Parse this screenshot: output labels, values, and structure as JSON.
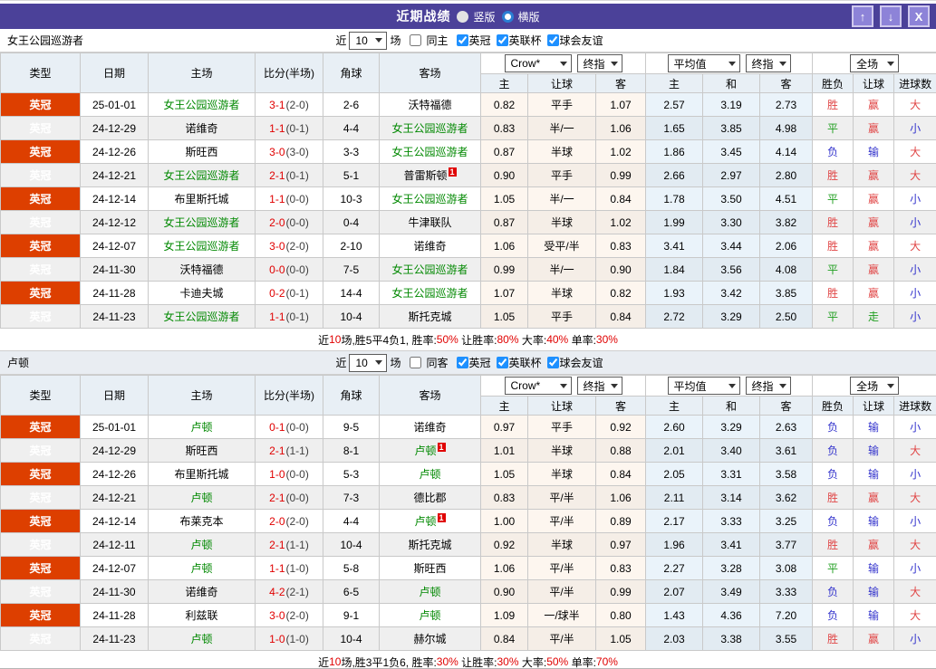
{
  "titlebar": {
    "title": "近期战绩",
    "radios": [
      {
        "label": "竖版",
        "selected": false
      },
      {
        "label": "横版",
        "selected": true
      }
    ],
    "icons": {
      "up": "↑",
      "down": "↓",
      "close": "X"
    }
  },
  "colors": {
    "accent_purple": "#4b4199",
    "button_purple": "#8d83d8",
    "league_red": "#dd3f00",
    "team_green": "#008800",
    "score_red": "#e00000",
    "result_red": "#e04545",
    "result_green": "#1f9e1f",
    "result_blue": "#3333cc",
    "checkbox_blue": "#1e90ff"
  },
  "table_header": {
    "cols": [
      "类型",
      "日期",
      "主场",
      "比分(半场)",
      "角球",
      "客场"
    ],
    "crow_select": "Crow*",
    "final_select": "终指",
    "avg_select": "平均值",
    "avg_final_select": "终指",
    "full_select": "全场",
    "sub": [
      "主",
      "让球",
      "客",
      "主",
      "和",
      "客",
      "胜负",
      "让球",
      "进球数"
    ]
  },
  "sections": [
    {
      "team": "女王公园巡游者",
      "filters": {
        "near": "近",
        "games": "10",
        "games_suffix": "场",
        "same_label": "同主",
        "same_checked": false,
        "comps": [
          {
            "label": "英冠",
            "checked": true
          },
          {
            "label": "英联杯",
            "checked": true
          },
          {
            "label": "球会友谊",
            "checked": true
          }
        ]
      },
      "rows": [
        {
          "league": "英冠",
          "date": "25-01-01",
          "home": "女王公园巡游者",
          "home_hl": true,
          "home_badge": "",
          "ft": "3-1",
          "ht": "(2-0)",
          "corners": "2-6",
          "away": "沃特福德",
          "away_hl": false,
          "away_badge": "",
          "crow": [
            "0.82",
            "平手",
            "1.07"
          ],
          "avg": [
            "2.57",
            "3.19",
            "2.73"
          ],
          "result": [
            "胜",
            "赢",
            "大"
          ]
        },
        {
          "league": "英冠",
          "date": "24-12-29",
          "home": "诺维奇",
          "home_hl": false,
          "home_badge": "",
          "ft": "1-1",
          "ht": "(0-1)",
          "corners": "4-4",
          "away": "女王公园巡游者",
          "away_hl": true,
          "away_badge": "",
          "crow": [
            "0.83",
            "半/一",
            "1.06"
          ],
          "avg": [
            "1.65",
            "3.85",
            "4.98"
          ],
          "result": [
            "平",
            "赢",
            "小"
          ]
        },
        {
          "league": "英冠",
          "date": "24-12-26",
          "home": "斯旺西",
          "home_hl": false,
          "home_badge": "",
          "ft": "3-0",
          "ht": "(3-0)",
          "corners": "3-3",
          "away": "女王公园巡游者",
          "away_hl": true,
          "away_badge": "",
          "crow": [
            "0.87",
            "半球",
            "1.02"
          ],
          "avg": [
            "1.86",
            "3.45",
            "4.14"
          ],
          "result": [
            "负",
            "输",
            "大"
          ]
        },
        {
          "league": "英冠",
          "date": "24-12-21",
          "home": "女王公园巡游者",
          "home_hl": true,
          "home_badge": "",
          "ft": "2-1",
          "ht": "(0-1)",
          "corners": "5-1",
          "away": "普雷斯顿",
          "away_hl": false,
          "away_badge": "1",
          "crow": [
            "0.90",
            "平手",
            "0.99"
          ],
          "avg": [
            "2.66",
            "2.97",
            "2.80"
          ],
          "result": [
            "胜",
            "赢",
            "大"
          ]
        },
        {
          "league": "英冠",
          "date": "24-12-14",
          "home": "布里斯托城",
          "home_hl": false,
          "home_badge": "",
          "ft": "1-1",
          "ht": "(0-0)",
          "corners": "10-3",
          "away": "女王公园巡游者",
          "away_hl": true,
          "away_badge": "",
          "crow": [
            "1.05",
            "半/一",
            "0.84"
          ],
          "avg": [
            "1.78",
            "3.50",
            "4.51"
          ],
          "result": [
            "平",
            "赢",
            "小"
          ]
        },
        {
          "league": "英冠",
          "date": "24-12-12",
          "home": "女王公园巡游者",
          "home_hl": true,
          "home_badge": "",
          "ft": "2-0",
          "ht": "(0-0)",
          "corners": "0-4",
          "away": "牛津联队",
          "away_hl": false,
          "away_badge": "",
          "crow": [
            "0.87",
            "半球",
            "1.02"
          ],
          "avg": [
            "1.99",
            "3.30",
            "3.82"
          ],
          "result": [
            "胜",
            "赢",
            "小"
          ]
        },
        {
          "league": "英冠",
          "date": "24-12-07",
          "home": "女王公园巡游者",
          "home_hl": true,
          "home_badge": "",
          "ft": "3-0",
          "ht": "(2-0)",
          "corners": "2-10",
          "away": "诺维奇",
          "away_hl": false,
          "away_badge": "",
          "crow": [
            "1.06",
            "受平/半",
            "0.83"
          ],
          "avg": [
            "3.41",
            "3.44",
            "2.06"
          ],
          "result": [
            "胜",
            "赢",
            "大"
          ]
        },
        {
          "league": "英冠",
          "date": "24-11-30",
          "home": "沃特福德",
          "home_hl": false,
          "home_badge": "",
          "ft": "0-0",
          "ht": "(0-0)",
          "corners": "7-5",
          "away": "女王公园巡游者",
          "away_hl": true,
          "away_badge": "",
          "crow": [
            "0.99",
            "半/一",
            "0.90"
          ],
          "avg": [
            "1.84",
            "3.56",
            "4.08"
          ],
          "result": [
            "平",
            "赢",
            "小"
          ]
        },
        {
          "league": "英冠",
          "date": "24-11-28",
          "home": "卡迪夫城",
          "home_hl": false,
          "home_badge": "",
          "ft": "0-2",
          "ht": "(0-1)",
          "corners": "14-4",
          "away": "女王公园巡游者",
          "away_hl": true,
          "away_badge": "",
          "crow": [
            "1.07",
            "半球",
            "0.82"
          ],
          "avg": [
            "1.93",
            "3.42",
            "3.85"
          ],
          "result": [
            "胜",
            "赢",
            "小"
          ]
        },
        {
          "league": "英冠",
          "date": "24-11-23",
          "home": "女王公园巡游者",
          "home_hl": true,
          "home_badge": "",
          "ft": "1-1",
          "ht": "(0-1)",
          "corners": "10-4",
          "away": "斯托克城",
          "away_hl": false,
          "away_badge": "",
          "crow": [
            "1.05",
            "平手",
            "0.84"
          ],
          "avg": [
            "2.72",
            "3.29",
            "2.50"
          ],
          "result": [
            "平",
            "走",
            "小"
          ]
        }
      ],
      "summary": {
        "p1": "近",
        "games": "10",
        "p2": "场,胜5平4负1, 胜率:",
        "win_rate": "50%",
        "p3": " 让胜率:",
        "asian_rate": "80%",
        "p4": " 大率:",
        "big_rate": "40%",
        "p5": " 单率:",
        "single_rate": "30%"
      }
    },
    {
      "team": "卢顿",
      "filters": {
        "near": "近",
        "games": "10",
        "games_suffix": "场",
        "same_label": "同客",
        "same_checked": false,
        "comps": [
          {
            "label": "英冠",
            "checked": true
          },
          {
            "label": "英联杯",
            "checked": true
          },
          {
            "label": "球会友谊",
            "checked": true
          }
        ]
      },
      "rows": [
        {
          "league": "英冠",
          "date": "25-01-01",
          "home": "卢顿",
          "home_hl": true,
          "home_badge": "",
          "ft": "0-1",
          "ht": "(0-0)",
          "corners": "9-5",
          "away": "诺维奇",
          "away_hl": false,
          "away_badge": "",
          "crow": [
            "0.97",
            "平手",
            "0.92"
          ],
          "avg": [
            "2.60",
            "3.29",
            "2.63"
          ],
          "result": [
            "负",
            "输",
            "小"
          ]
        },
        {
          "league": "英冠",
          "date": "24-12-29",
          "home": "斯旺西",
          "home_hl": false,
          "home_badge": "",
          "ft": "2-1",
          "ht": "(1-1)",
          "corners": "8-1",
          "away": "卢顿",
          "away_hl": true,
          "away_badge": "1",
          "crow": [
            "1.01",
            "半球",
            "0.88"
          ],
          "avg": [
            "2.01",
            "3.40",
            "3.61"
          ],
          "result": [
            "负",
            "输",
            "大"
          ]
        },
        {
          "league": "英冠",
          "date": "24-12-26",
          "home": "布里斯托城",
          "home_hl": false,
          "home_badge": "",
          "ft": "1-0",
          "ht": "(0-0)",
          "corners": "5-3",
          "away": "卢顿",
          "away_hl": true,
          "away_badge": "",
          "crow": [
            "1.05",
            "半球",
            "0.84"
          ],
          "avg": [
            "2.05",
            "3.31",
            "3.58"
          ],
          "result": [
            "负",
            "输",
            "小"
          ]
        },
        {
          "league": "英冠",
          "date": "24-12-21",
          "home": "卢顿",
          "home_hl": true,
          "home_badge": "",
          "ft": "2-1",
          "ht": "(0-0)",
          "corners": "7-3",
          "away": "德比郡",
          "away_hl": false,
          "away_badge": "",
          "crow": [
            "0.83",
            "平/半",
            "1.06"
          ],
          "avg": [
            "2.11",
            "3.14",
            "3.62"
          ],
          "result": [
            "胜",
            "赢",
            "大"
          ]
        },
        {
          "league": "英冠",
          "date": "24-12-14",
          "home": "布莱克本",
          "home_hl": false,
          "home_badge": "",
          "ft": "2-0",
          "ht": "(2-0)",
          "corners": "4-4",
          "away": "卢顿",
          "away_hl": true,
          "away_badge": "1",
          "crow": [
            "1.00",
            "平/半",
            "0.89"
          ],
          "avg": [
            "2.17",
            "3.33",
            "3.25"
          ],
          "result": [
            "负",
            "输",
            "小"
          ]
        },
        {
          "league": "英冠",
          "date": "24-12-11",
          "home": "卢顿",
          "home_hl": true,
          "home_badge": "",
          "ft": "2-1",
          "ht": "(1-1)",
          "corners": "10-4",
          "away": "斯托克城",
          "away_hl": false,
          "away_badge": "",
          "crow": [
            "0.92",
            "半球",
            "0.97"
          ],
          "avg": [
            "1.96",
            "3.41",
            "3.77"
          ],
          "result": [
            "胜",
            "赢",
            "大"
          ]
        },
        {
          "league": "英冠",
          "date": "24-12-07",
          "home": "卢顿",
          "home_hl": true,
          "home_badge": "",
          "ft": "1-1",
          "ht": "(1-0)",
          "corners": "5-8",
          "away": "斯旺西",
          "away_hl": false,
          "away_badge": "",
          "crow": [
            "1.06",
            "平/半",
            "0.83"
          ],
          "avg": [
            "2.27",
            "3.28",
            "3.08"
          ],
          "result": [
            "平",
            "输",
            "小"
          ]
        },
        {
          "league": "英冠",
          "date": "24-11-30",
          "home": "诺维奇",
          "home_hl": false,
          "home_badge": "",
          "ft": "4-2",
          "ht": "(2-1)",
          "corners": "6-5",
          "away": "卢顿",
          "away_hl": true,
          "away_badge": "",
          "crow": [
            "0.90",
            "平/半",
            "0.99"
          ],
          "avg": [
            "2.07",
            "3.49",
            "3.33"
          ],
          "result": [
            "负",
            "输",
            "大"
          ]
        },
        {
          "league": "英冠",
          "date": "24-11-28",
          "home": "利兹联",
          "home_hl": false,
          "home_badge": "",
          "ft": "3-0",
          "ht": "(2-0)",
          "corners": "9-1",
          "away": "卢顿",
          "away_hl": true,
          "away_badge": "",
          "crow": [
            "1.09",
            "一/球半",
            "0.80"
          ],
          "avg": [
            "1.43",
            "4.36",
            "7.20"
          ],
          "result": [
            "负",
            "输",
            "大"
          ]
        },
        {
          "league": "英冠",
          "date": "24-11-23",
          "home": "卢顿",
          "home_hl": true,
          "home_badge": "",
          "ft": "1-0",
          "ht": "(1-0)",
          "corners": "10-4",
          "away": "赫尔城",
          "away_hl": false,
          "away_badge": "",
          "crow": [
            "0.84",
            "平/半",
            "1.05"
          ],
          "avg": [
            "2.03",
            "3.38",
            "3.55"
          ],
          "result": [
            "胜",
            "赢",
            "小"
          ]
        }
      ],
      "summary": {
        "p1": "近",
        "games": "10",
        "p2": "场,胜3平1负6, 胜率:",
        "win_rate": "30%",
        "p3": " 让胜率:",
        "asian_rate": "30%",
        "p4": " 大率:",
        "big_rate": "50%",
        "p5": " 单率:",
        "single_rate": "70%"
      }
    }
  ]
}
